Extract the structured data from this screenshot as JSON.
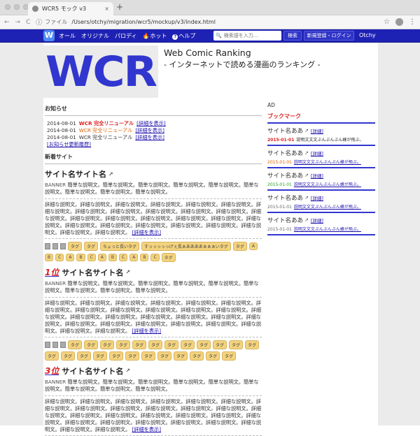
{
  "browser": {
    "tab_title": "WCR5 モック v3",
    "tab_close": "×",
    "new_tab": "+",
    "file_label": "ファイル",
    "url": "/Users/otchy/migration/wcr5/mockup/v3/index.html",
    "nav_back": "←",
    "nav_forward": "→",
    "nav_reload": "C",
    "info_icon": "ⓘ",
    "star_icon": "☆",
    "menu_icon": "⋮"
  },
  "gnav": {
    "logo": "W",
    "items": [
      "オール",
      "オリジナル",
      "パロディ",
      "ホット",
      "ヘルプ"
    ],
    "hot_icon": "🔥",
    "help_icon": "?",
    "search_icon": "🔍",
    "search_placeholder": "検索語を入力...",
    "search_button": "検索",
    "register_button": "新規登録・ログイン",
    "user": "Otchy"
  },
  "hero": {
    "logo_text": "WCR",
    "title": "Web Comic Ranking",
    "subtitle": "- インターネットで読める漫画のランキング -"
  },
  "notices": {
    "heading": "お知らせ",
    "items": [
      {
        "date": "2014-08-01",
        "text": "WCR 完全リニューアル",
        "link": "[詳細を表示]",
        "color": "#dd2222"
      },
      {
        "date": "2014-08-01",
        "text": "WCR 完全リニューアル",
        "link": "[詳細を表示]",
        "color": "#e06000"
      },
      {
        "date": "2014-08-01",
        "text": "WCR 完全リニューアル",
        "link": "[詳細を表示]",
        "color": "#333333"
      }
    ],
    "history_link": "[お知らせ更新履歴]"
  },
  "new_sites": {
    "heading": "新着サイト",
    "sites": [
      {
        "rank": "",
        "name": "サイト名サイト名",
        "ext_icon": "↗",
        "banner": "BANNER",
        "short": "簡単な説明文。簡単な説明文。簡単な説明文。簡単な説明文。簡単な説明文。簡単な説明文。簡単な説明文。簡単な説明文。簡単な説明文。",
        "long": "詳細な説明文。詳細な説明文。詳細な説明文。詳細な説明文。詳細な説明文。詳細な説明文。詳細な説明文。詳細な説明文。詳細な説明文。詳細な説明文。詳細な説明文。詳細な説明文。詳細な説明文。詳細な説明文。詳細な説明文。詳細な説明文。詳細な説明文。詳細な説明文。詳細な説明文。詳細な説明文。詳細な説明文。詳細な説明文。詳細な説明文。詳細な説明文。詳細な説明文。詳細な説明文。詳細な説明文。",
        "long_link": "[詳細を表示]",
        "tags": [
          "タグ",
          "タグ",
          "ちょっと長いタグ",
          "すっっっっっげぇ長ぁああああぁぁぁいタグ",
          "タグ",
          "A",
          "B",
          "C",
          "A",
          "B",
          "C",
          "A",
          "B",
          "C",
          "A",
          "B",
          "C",
          "タグ"
        ]
      },
      {
        "rank": "1位",
        "name": "サイト名サイト名",
        "ext_icon": "↗",
        "banner": "BANNER",
        "short": "簡単な説明文。簡単な説明文。簡単な説明文。簡単な説明文。簡単な説明文。簡単な説明文。簡単な説明文。簡単な説明文。簡単な説明文。",
        "long": "詳細な説明文。詳細な説明文。詳細な説明文。詳細な説明文。詳細な説明文。詳細な説明文。詳細な説明文。詳細な説明文。詳細な説明文。詳細な説明文。詳細な説明文。詳細な説明文。詳細な説明文。詳細な説明文。詳細な説明文。詳細な説明文。詳細な説明文。詳細な説明文。詳細な説明文。詳細な説明文。詳細な説明文。詳細な説明文。詳細な説明文。詳細な説明文。詳細な説明文。詳細な説明文。詳細な説明文。",
        "long_link": "[詳細を表示]",
        "tags": [
          "タグ",
          "タグ",
          "タグ",
          "タグ",
          "タグ",
          "タグ",
          "タグ",
          "タグ",
          "タグ",
          "タグ",
          "タグ",
          "タグ",
          "タグ",
          "タグ",
          "タグ",
          "タグ",
          "タグ",
          "タグ",
          "タグ",
          "タグ",
          "タグ",
          "タグ",
          "タグ",
          "タグ"
        ]
      },
      {
        "rank": "3位",
        "name": "サイト名サイト名",
        "ext_icon": "↗",
        "banner": "BANNER",
        "short": "簡単な説明文。簡単な説明文。簡単な説明文。簡単な説明文。簡単な説明文。簡単な説明文。簡単な説明文。簡単な説明文。簡単な説明文。",
        "long": "詳細な説明文。詳細な説明文。詳細な説明文。詳細な説明文。詳細な説明文。詳細な説明文。詳細な説明文。詳細な説明文。詳細な説明文。詳細な説明文。詳細な説明文。詳細な説明文。詳細な説明文。詳細な説明文。詳細な説明文。詳細な説明文。詳細な説明文。詳細な説明文。詳細な説明文。詳細な説明文。詳細な説明文。詳細な説明文。詳細な説明文。詳細な説明文。詳細な説明文。詳細な説明文。詳細な説明文。",
        "long_link": "[詳細を表示]",
        "tags": []
      }
    ]
  },
  "sidebar": {
    "ad": "AD",
    "bookmark_heading": "ブックマーク",
    "bookmarks": [
      {
        "name": "サイト名ああ",
        "link": "[詳細]",
        "date": "2015-01-01",
        "desc": "説明文文文ぶんぶんぶん蜂が飛ぶ。",
        "style": "c-red"
      },
      {
        "name": "サイト名ああ",
        "link": "[詳細]",
        "date": "2015-01-01",
        "desc": "説明文文文ぶんぶんぶん蜂が飛ぶ。",
        "style": "c-orange"
      },
      {
        "name": "サイト名ああ",
        "link": "[詳細]",
        "date": "2015-01-01",
        "desc": "説明文文文ぶんぶんぶん蜂が飛ぶ。",
        "style": "c-green"
      },
      {
        "name": "サイト名ああ",
        "link": "[詳細]",
        "date": "2015-01-01",
        "desc": "説明文文文ぶんぶんぶん蜂が飛ぶ。",
        "style": "c-gray"
      },
      {
        "name": "サイト名ああ",
        "link": "[詳細]",
        "date": "2015-01-01",
        "desc": "説明文文文ぶんぶんぶん蜂が飛ぶ。",
        "style": "c-gray"
      }
    ]
  }
}
